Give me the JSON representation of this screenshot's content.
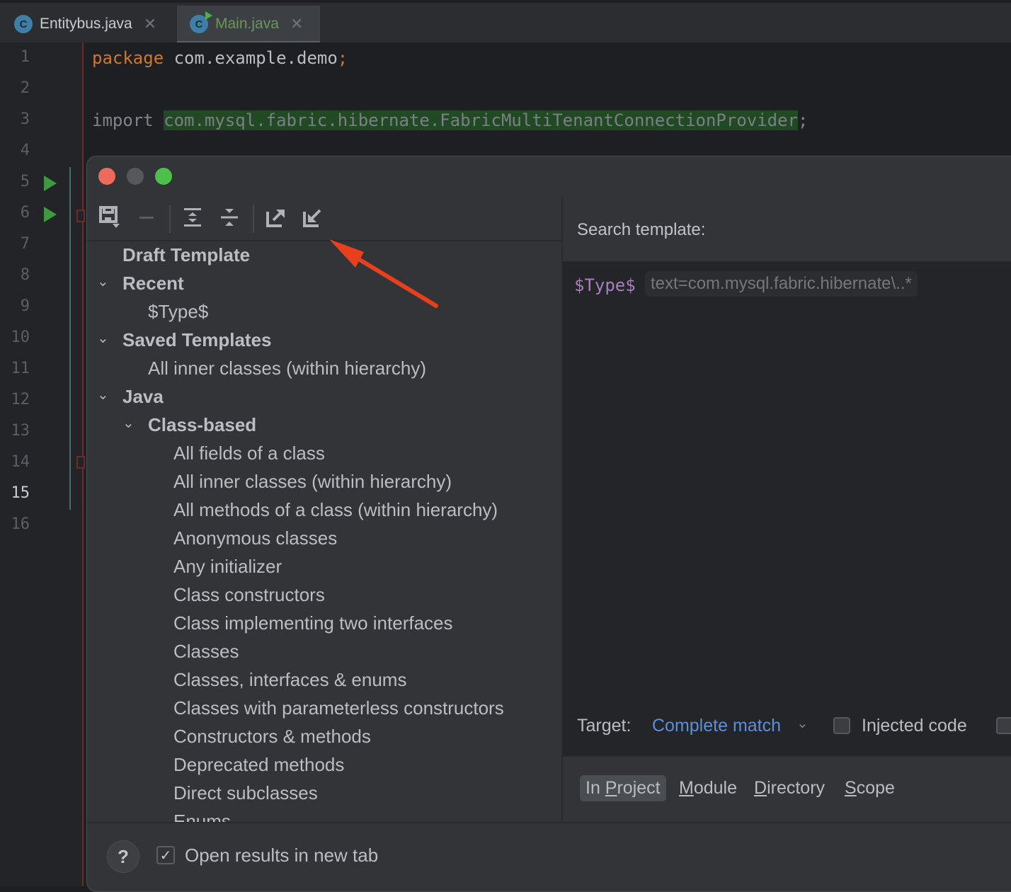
{
  "tabs": [
    {
      "label": "Entitybus.java",
      "icon": "java-class-icon",
      "active": false
    },
    {
      "label": "Main.java",
      "icon": "java-class-runnable-icon",
      "active": true
    }
  ],
  "editor": {
    "line_numbers": [
      "1",
      "2",
      "3",
      "4",
      "5",
      "6",
      "7",
      "8",
      "9",
      "10",
      "11",
      "12",
      "13",
      "14",
      "15",
      "16"
    ],
    "active_line": "15",
    "line1": {
      "keyword": "package",
      "rest": " com.example.demo",
      "semi": ";"
    },
    "line3": {
      "keyword": "import",
      "highlighted": "com.mysql.fabric.hibernate.FabricMultiTenantConnectionProvider",
      "semi": ";"
    }
  },
  "dialog": {
    "traffic_lights": {
      "close": "#ed6a5e",
      "minimize": "#55575b",
      "maximize": "#4dbf4a"
    },
    "toolbar": {
      "save": "save-template-icon",
      "remove": "remove-icon",
      "expand_all": "expand-all-icon",
      "collapse_all": "collapse-all-icon",
      "export": "export-icon",
      "import": "import-icon"
    },
    "tree": {
      "draft": "Draft Template",
      "recent": {
        "label": "Recent",
        "items": [
          "$Type$"
        ]
      },
      "saved": {
        "label": "Saved Templates",
        "items": [
          "All inner classes (within hierarchy)"
        ]
      },
      "java": {
        "label": "Java",
        "class_based": {
          "label": "Class-based",
          "items": [
            "All fields of a class",
            "All inner classes (within hierarchy)",
            "All methods of a class (within hierarchy)",
            "Anonymous classes",
            "Any initializer",
            "Class constructors",
            "Class implementing two interfaces",
            "Classes",
            "Classes, interfaces & enums",
            "Classes with parameterless constructors",
            "Constructors & methods",
            "Deprecated methods",
            "Direct subclasses",
            "Enums"
          ]
        }
      }
    },
    "search_template_label": "Search template:",
    "template": {
      "variable": "$Type$",
      "hint": "text=com.mysql.fabric.hibernate\\..*"
    },
    "target": {
      "label": "Target:",
      "value": "Complete match"
    },
    "injected_code": {
      "label": "Injected code",
      "checked": false
    },
    "scopes": [
      {
        "pre": "In ",
        "mnemonic": "P",
        "post": "roject",
        "selected": true
      },
      {
        "pre": "",
        "mnemonic": "M",
        "post": "odule",
        "selected": false
      },
      {
        "pre": "",
        "mnemonic": "D",
        "post": "irectory",
        "selected": false
      },
      {
        "pre": "",
        "mnemonic": "S",
        "post": "cope",
        "selected": false
      }
    ],
    "help": "?",
    "open_in_new_tab": {
      "label": "Open results in new tab",
      "checked": true
    }
  },
  "annotation": {
    "type": "arrow",
    "color": "#e8401c",
    "points_to": "import-icon"
  }
}
